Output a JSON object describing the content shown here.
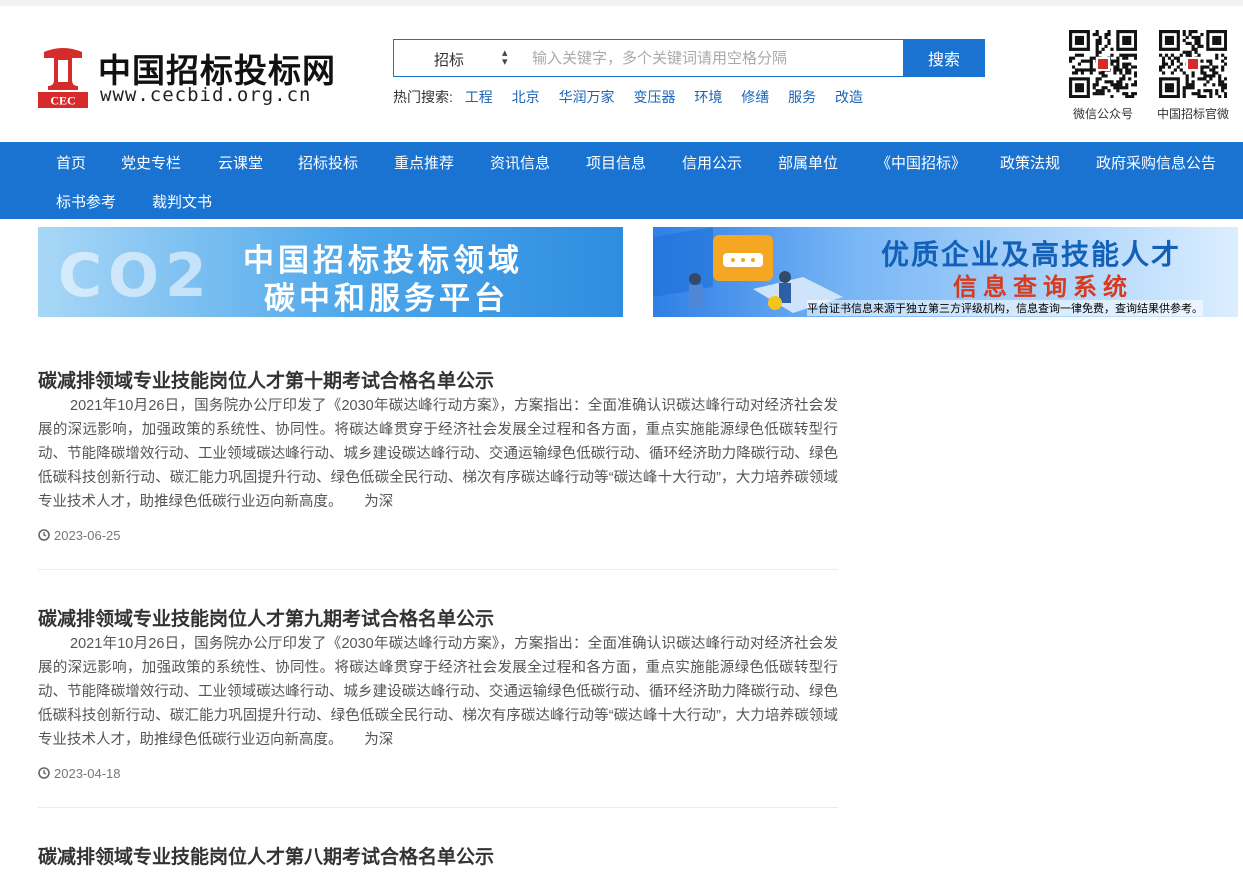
{
  "header": {
    "logo_mark_text": "CEC",
    "logo_cn": "中国招标投标网",
    "logo_en": "www.cecbid.org.cn"
  },
  "search": {
    "category": "招标",
    "placeholder": "输入关键字，多个关键词请用空格分隔",
    "button_label": "搜索"
  },
  "hot_search": {
    "label": "热门搜索:",
    "items": [
      "工程",
      "北京",
      "华润万家",
      "变压器",
      "环境",
      "修缮",
      "服务",
      "改造"
    ]
  },
  "qr_codes": [
    {
      "label": "微信公众号"
    },
    {
      "label": "中国招标官微"
    }
  ],
  "nav": {
    "items": [
      "首页",
      "党史专栏",
      "云课堂",
      "招标投标",
      "重点推荐",
      "资讯信息",
      "项目信息",
      "信用公示",
      "部属单位",
      "《中国招标》",
      "政策法规",
      "政府采购信息公告",
      "标书参考",
      "裁判文书"
    ]
  },
  "banners": {
    "left": {
      "bg_text": "CO2",
      "line1": "中国招标投标领域",
      "line2": "碳中和服务平台"
    },
    "right": {
      "line1": "优质企业及高技能人才",
      "line2": "信息查询系统",
      "note": "平台证书信息来源于独立第三方评级机构，信息查询一律免费，查询结果供参考。"
    }
  },
  "articles": [
    {
      "title": "碳减排领域专业技能岗位人才第十期考试合格名单公示",
      "body": "2021年10月26日，国务院办公厅印发了《2030年碳达峰行动方案》，方案指出：全面准确认识碳达峰行动对经济社会发展的深远影响，加强政策的系统性、协同性。将碳达峰贯穿于经济社会发展全过程和各方面，重点实施能源绿色低碳转型行动、节能降碳增效行动、工业领域碳达峰行动、城乡建设碳达峰行动、交通运输绿色低碳行动、循环经济助力降碳行动、绿色低碳科技创新行动、碳汇能力巩固提升行动、绿色低碳全民行动、梯次有序碳达峰行动等“碳达峰十大行动”，大力培养碳领域专业技术人才，助推绿色低碳行业迈向新高度。　　为深",
      "date": "2023-06-25"
    },
    {
      "title": "碳减排领域专业技能岗位人才第九期考试合格名单公示",
      "body": "2021年10月26日，国务院办公厅印发了《2030年碳达峰行动方案》，方案指出：全面准确认识碳达峰行动对经济社会发展的深远影响，加强政策的系统性、协同性。将碳达峰贯穿于经济社会发展全过程和各方面，重点实施能源绿色低碳转型行动、节能降碳增效行动、工业领域碳达峰行动、城乡建设碳达峰行动、交通运输绿色低碳行动、循环经济助力降碳行动、绿色低碳科技创新行动、碳汇能力巩固提升行动、绿色低碳全民行动、梯次有序碳达峰行动等“碳达峰十大行动”，大力培养碳领域专业技术人才，助推绿色低碳行业迈向新高度。　　为深",
      "date": "2023-04-18"
    },
    {
      "title": "碳减排领域专业技能岗位人才第八期考试合格名单公示",
      "body": "",
      "date": ""
    }
  ],
  "colors": {
    "brand_blue": "#1a73d1",
    "logo_red": "#d62b2b",
    "link_blue": "#1a64b8"
  }
}
